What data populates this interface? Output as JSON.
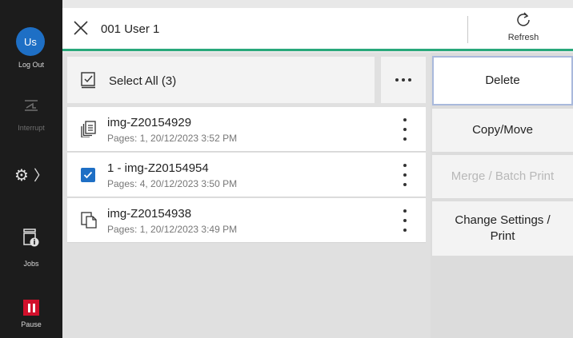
{
  "sidebar": {
    "avatar": "Us",
    "logout": "Log Out",
    "interrupt": "Interrupt",
    "jobs": "Jobs",
    "pause": "Pause"
  },
  "header": {
    "title": "001 User 1",
    "refresh": "Refresh"
  },
  "list": {
    "select_all": "Select All (3)",
    "items": [
      {
        "name": "img-Z20154929",
        "meta": "Pages: 1, 20/12/2023 3:52 PM",
        "icon": "document-stack-icon",
        "checked": false
      },
      {
        "name": "1 - img-Z20154954",
        "meta": "Pages: 4, 20/12/2023 3:50 PM",
        "icon": "checkbox-checked-icon",
        "checked": true
      },
      {
        "name": "img-Z20154938",
        "meta": "Pages: 1, 20/12/2023 3:49 PM",
        "icon": "document-copy-icon",
        "checked": false
      }
    ]
  },
  "actions": {
    "delete": "Delete",
    "copy_move": "Copy/Move",
    "merge": "Merge / Batch Print",
    "change_settings": "Change Settings / Print"
  },
  "colors": {
    "accent": "#28a87b",
    "brand_blue": "#1e6fc5",
    "pause_red": "#d1102b"
  }
}
